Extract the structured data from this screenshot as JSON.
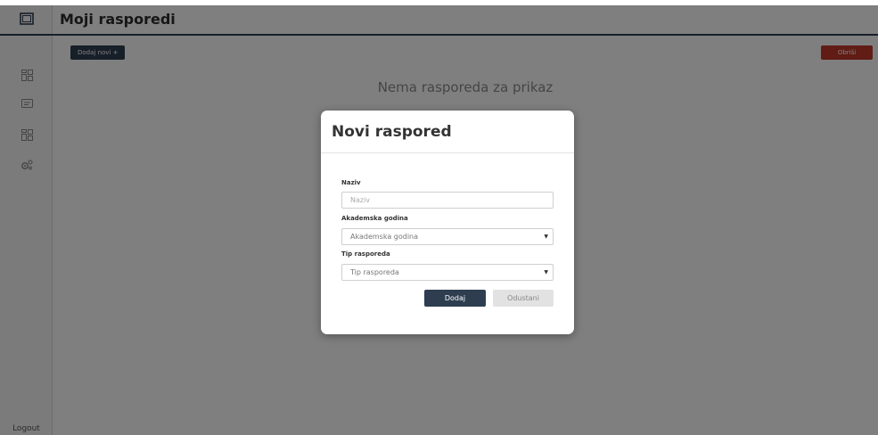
{
  "header": {
    "title": "Moji rasporedi"
  },
  "sidebar": {
    "icons": [
      "window-icon",
      "grid-icon",
      "message-icon",
      "grid-icon",
      "gears-icon"
    ],
    "logout_label": "Logout"
  },
  "toolbar": {
    "add_label": "Dodaj novi +",
    "delete_label": "Obriši"
  },
  "main": {
    "empty_message": "Nema rasporeda za prikaz"
  },
  "modal": {
    "title": "Novi raspored",
    "naziv_label": "Naziv",
    "naziv_placeholder": "Naziv",
    "godina_label": "Akademska godina",
    "godina_value": "Akademska godina",
    "tip_label": "Tip rasporeda",
    "tip_value": "Tip rasporeda",
    "submit_label": "Dodaj",
    "cancel_label": "Odustani"
  },
  "colors": {
    "primary": "#2e3e50",
    "danger": "#c0392b",
    "overlay": "rgba(0,0,0,0.5)"
  }
}
